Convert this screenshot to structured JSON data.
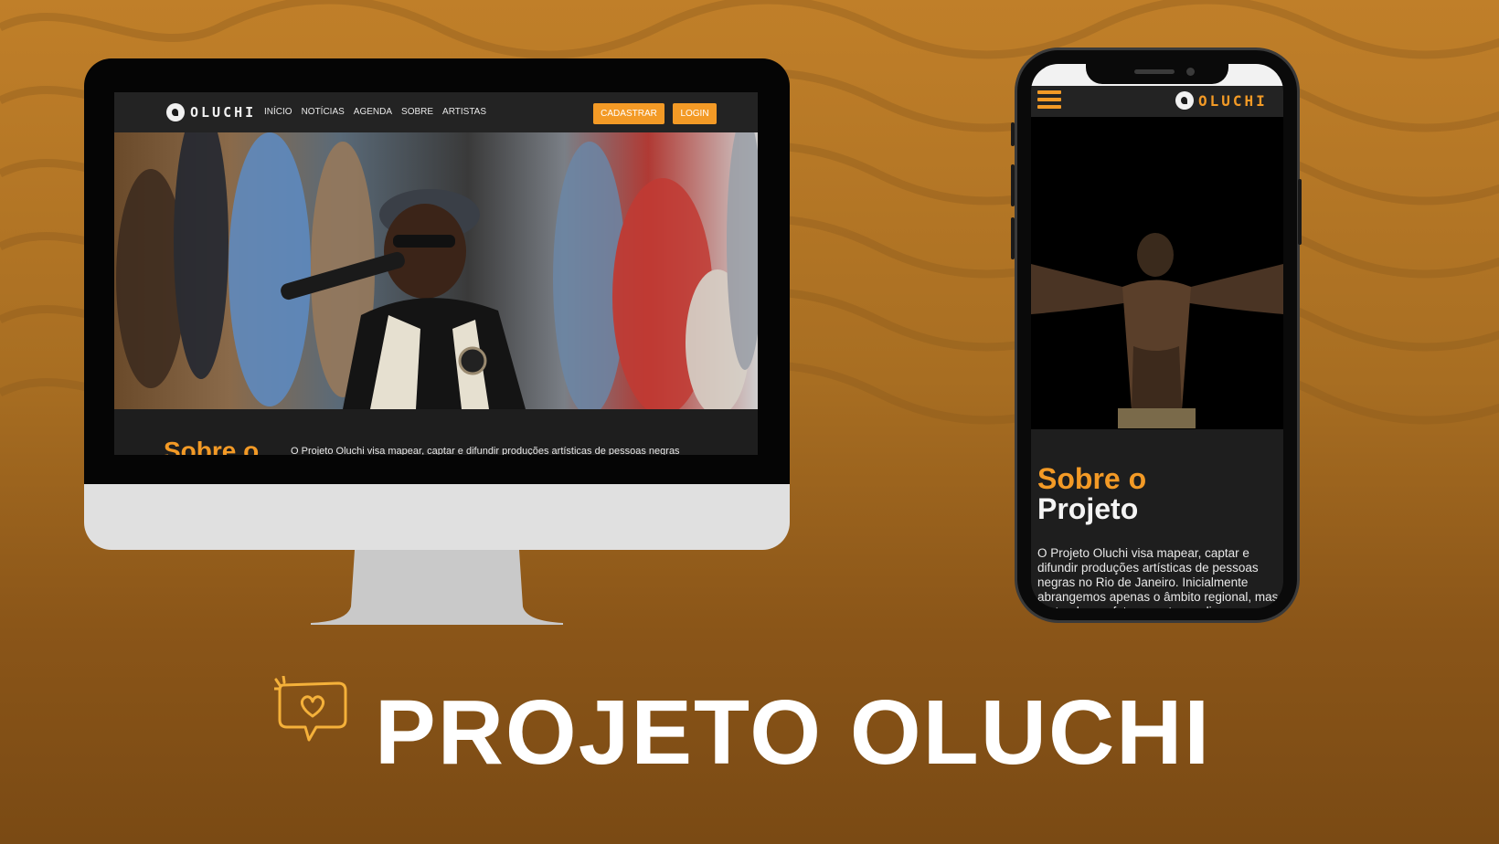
{
  "brand": {
    "accent": "#f39a26",
    "background": "#b87a26"
  },
  "desktop": {
    "logo_text": "OLUCHI",
    "nav": [
      "INÍCIO",
      "NOTÍCIAS",
      "AGENDA",
      "SOBRE",
      "ARTISTAS"
    ],
    "cadastrar_label": "CADASTRAR",
    "login_label": "LOGIN",
    "about_title": "Sobre o",
    "about_text": "O Projeto Oluchi visa mapear, captar e difundir produções artísticas de pessoas negras"
  },
  "mobile": {
    "logo_text": "OLUCHI",
    "about_title_1": "Sobre o",
    "about_title_2": "Projeto",
    "about_text": "O Projeto Oluchi visa mapear, captar e difundir produções artísticas de pessoas negras no Rio de Janeiro. Inicialmente abrangemos apenas o âmbito regional, mas pretendemos futuramente ampliar"
  },
  "headline": "PROJETO OLUCHI",
  "icons": {
    "chat_heart": "chat-heart-icon",
    "menu": "hamburger-menu-icon",
    "logo": "oluchi-logo-icon"
  }
}
